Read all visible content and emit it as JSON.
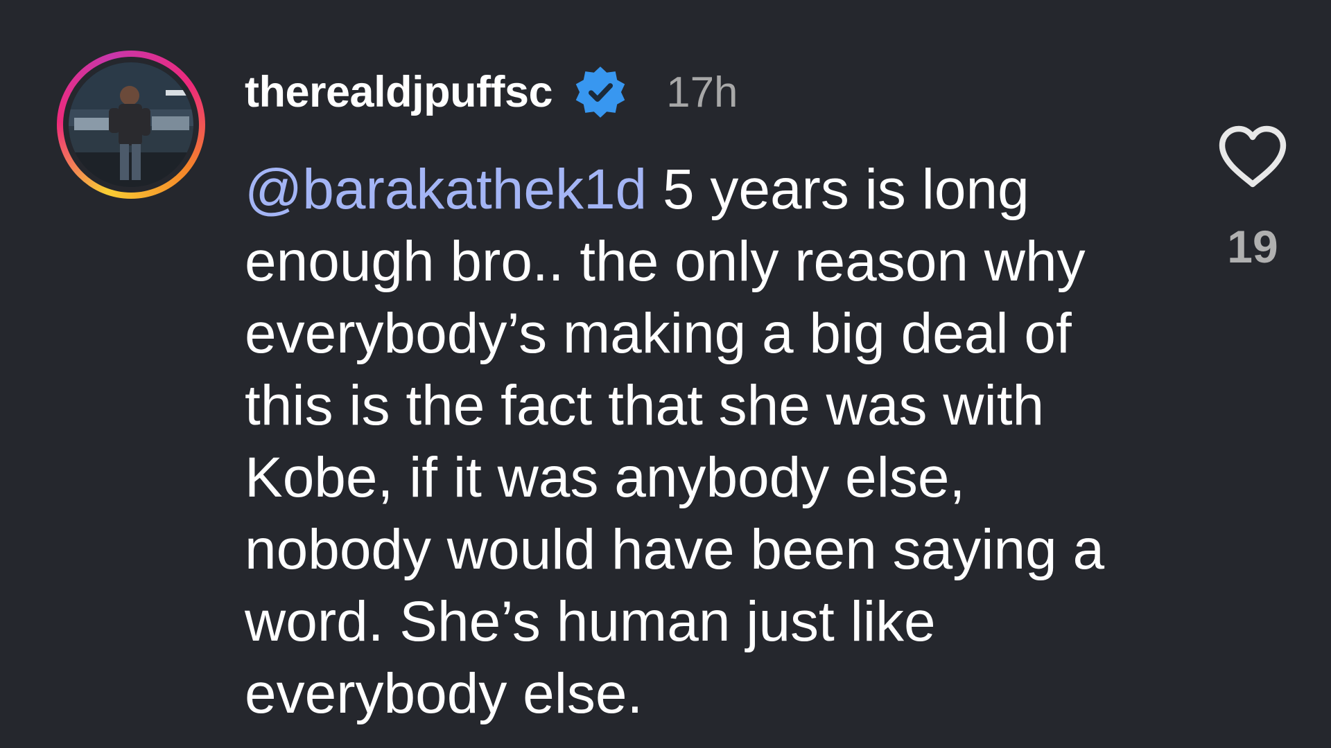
{
  "comment": {
    "username": "therealdjpuffsc",
    "verified": true,
    "timestamp": "17h",
    "mention": "@barakathek1d",
    "text": " 5 years is long enough bro.. the only reason why everybody’s making a big deal of this is the fact that she was with Kobe, if it was anybody else, nobody would have been saying a word. She’s human just like everybody else.",
    "likes": "19"
  },
  "icons": {
    "avatar": "profile-photo",
    "verified": "verified-badge-icon",
    "like": "heart-outline-icon"
  },
  "colors": {
    "background": "#25272d",
    "mention": "#a4b5f5",
    "verified": "#3897f0",
    "muted_text": "#a8a8a8",
    "story_ring": [
      "#f9ce34",
      "#ee2a7b",
      "#c837ab"
    ]
  }
}
